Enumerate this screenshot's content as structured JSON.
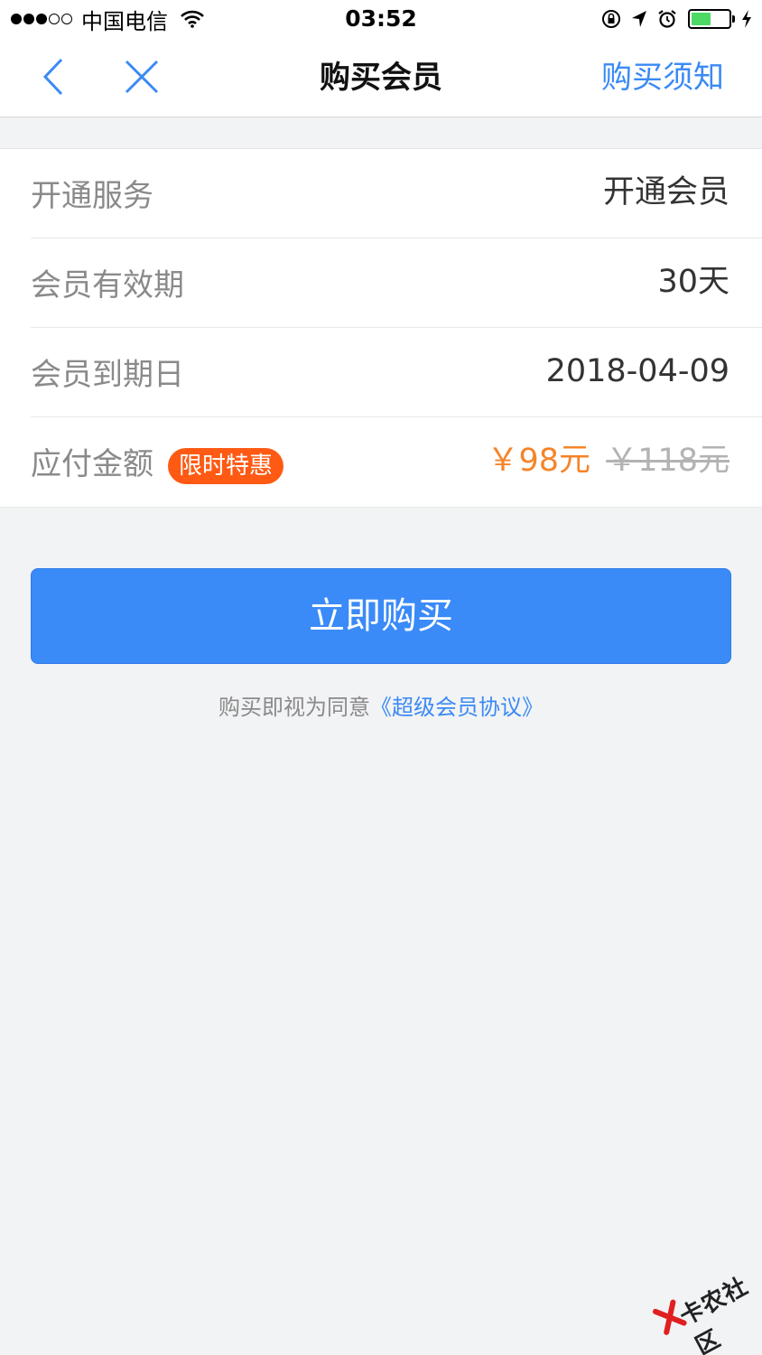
{
  "status_bar": {
    "carrier": "中国电信",
    "time": "03:52"
  },
  "nav": {
    "title": "购买会员",
    "right_link": "购买须知"
  },
  "details": {
    "service_label": "开通服务",
    "service_value": "开通会员",
    "validity_label": "会员有效期",
    "validity_value": "30天",
    "expiry_label": "会员到期日",
    "expiry_value": "2018-04-09",
    "amount_label": "应付金额",
    "badge": "限时特惠",
    "price_now": "￥98元",
    "price_original": "￥118元"
  },
  "buy_button": "立即购买",
  "agreement": {
    "prefix": "购买即视为同意",
    "link": "《超级会员协议》"
  },
  "watermark": "卡农社区",
  "colors": {
    "accent": "#3a8af8",
    "badge": "#ff5a14",
    "price": "#f5852a",
    "battery": "#4cd964"
  }
}
